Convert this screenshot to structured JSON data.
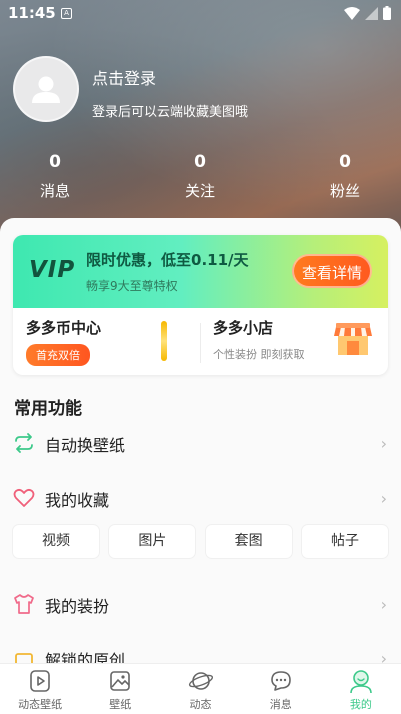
{
  "status_bar": {
    "time": "11:45",
    "sim_label": "A"
  },
  "profile": {
    "login_title": "点击登录",
    "login_subtitle": "登录后可以云端收藏美图哦"
  },
  "stats": [
    {
      "value": "0",
      "label": "消息"
    },
    {
      "value": "0",
      "label": "关注"
    },
    {
      "value": "0",
      "label": "粉丝"
    }
  ],
  "vip": {
    "logo": "VIP",
    "title": "限时优惠，低至0.11/天",
    "subtitle": "畅享9大至尊特权",
    "button_label": "查看详情"
  },
  "coin_center": {
    "title": "多多币中心",
    "badge": "首充双倍"
  },
  "shop": {
    "title": "多多小店",
    "subtitle": "个性装扮 即刻获取"
  },
  "common_functions": {
    "title": "常用功能",
    "items": [
      {
        "label": "自动换壁纸",
        "icon": "refresh-icon"
      },
      {
        "label": "我的收藏",
        "icon": "heart-icon"
      },
      {
        "label": "我的装扮",
        "icon": "shirt-icon"
      },
      {
        "label": "解锁的原创",
        "icon": "unlock-icon"
      }
    ],
    "collection_chips": [
      "视频",
      "图片",
      "套图",
      "帖子"
    ]
  },
  "tab_bar": [
    {
      "label": "动态壁纸",
      "icon": "play-icon",
      "active": false
    },
    {
      "label": "壁纸",
      "icon": "image-icon",
      "active": false
    },
    {
      "label": "动态",
      "icon": "planet-icon",
      "active": false
    },
    {
      "label": "消息",
      "icon": "chat-icon",
      "active": false
    },
    {
      "label": "我的",
      "icon": "profile-icon",
      "active": true
    }
  ],
  "colors": {
    "accent": "#3cc98a",
    "vip_button": "#ff6a1f",
    "chevron": "#bbbbbb"
  }
}
